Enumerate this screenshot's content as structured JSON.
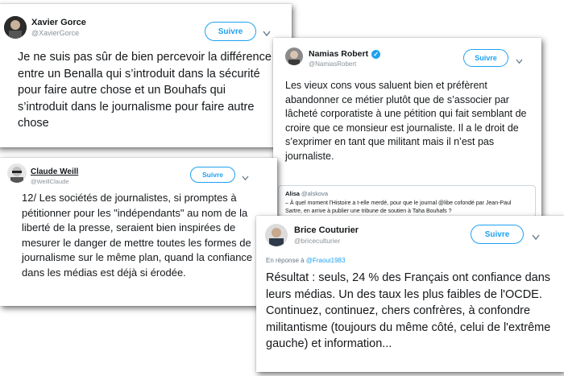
{
  "tweets": {
    "xavier": {
      "name": "Xavier Gorce",
      "handle": "@XavierGorce",
      "follow_label": "Suivre",
      "chevron_icon": "chevron-down-icon",
      "text": "Je ne suis pas sûr de bien percevoir la différence entre un Benalla qui s’introduit dans la sécurité pour faire autre chose et un Bouhafs qui s’introduit dans le journalisme pour faire autre chose"
    },
    "namias": {
      "name": "Namias Robert",
      "handle": "@NamiasRobert",
      "verified_icon": "verified-badge-icon",
      "follow_label": "Suivre",
      "chevron_icon": "chevron-down-icon",
      "text": "Les vieux cons vous saluent bien et préfèrent abandonner ce métier plutôt que de s’associer par lâcheté corporatiste à une pétition qui fait semblant de croire que ce monsieur est journaliste. Il a le droit de s’exprimer en tant que militant  mais il n’est pas journaliste.",
      "quote": {
        "author": "Alisa",
        "handle": "@alskova",
        "text": "– À quel moment l'Histoire a t-elle merdé, pour que le journal @libe cofondé par Jean-Paul Sartre, en arrive à publier une tribune de soutien à Taha Bouhafs ?"
      }
    },
    "claude": {
      "name": "Claude Weill",
      "handle": "@WeillClaude",
      "follow_label": "Suivre",
      "chevron_icon": "chevron-down-icon",
      "text": "12/ Les sociétés de journalistes, si promptes à pétitionner pour les \"indépendants\" au nom de la liberté de la presse, seraient bien inspirées de mesurer le danger de mettre toutes les formes de journalisme sur le même plan, quand la confiance dans les médias est déjà si érodée."
    },
    "brice": {
      "name": "Brice Couturier",
      "handle": "@briceculturier",
      "follow_label": "Suivre",
      "chevron_icon": "chevron-down-icon",
      "reply_prefix": "En réponse à",
      "reply_handle": "@Fraoui1983",
      "text": "Résultat : seuls, 24 % des Français ont confiance dans leurs médias. Un des taux les plus faibles de l'OCDE. Continuez, continuez, chers confrères, à confondre militantisme (toujours du même côté, celui de l'extrême gauche) et information..."
    }
  },
  "colors": {
    "accent": "#1da1f2",
    "text": "#14171a",
    "muted": "#657786"
  }
}
